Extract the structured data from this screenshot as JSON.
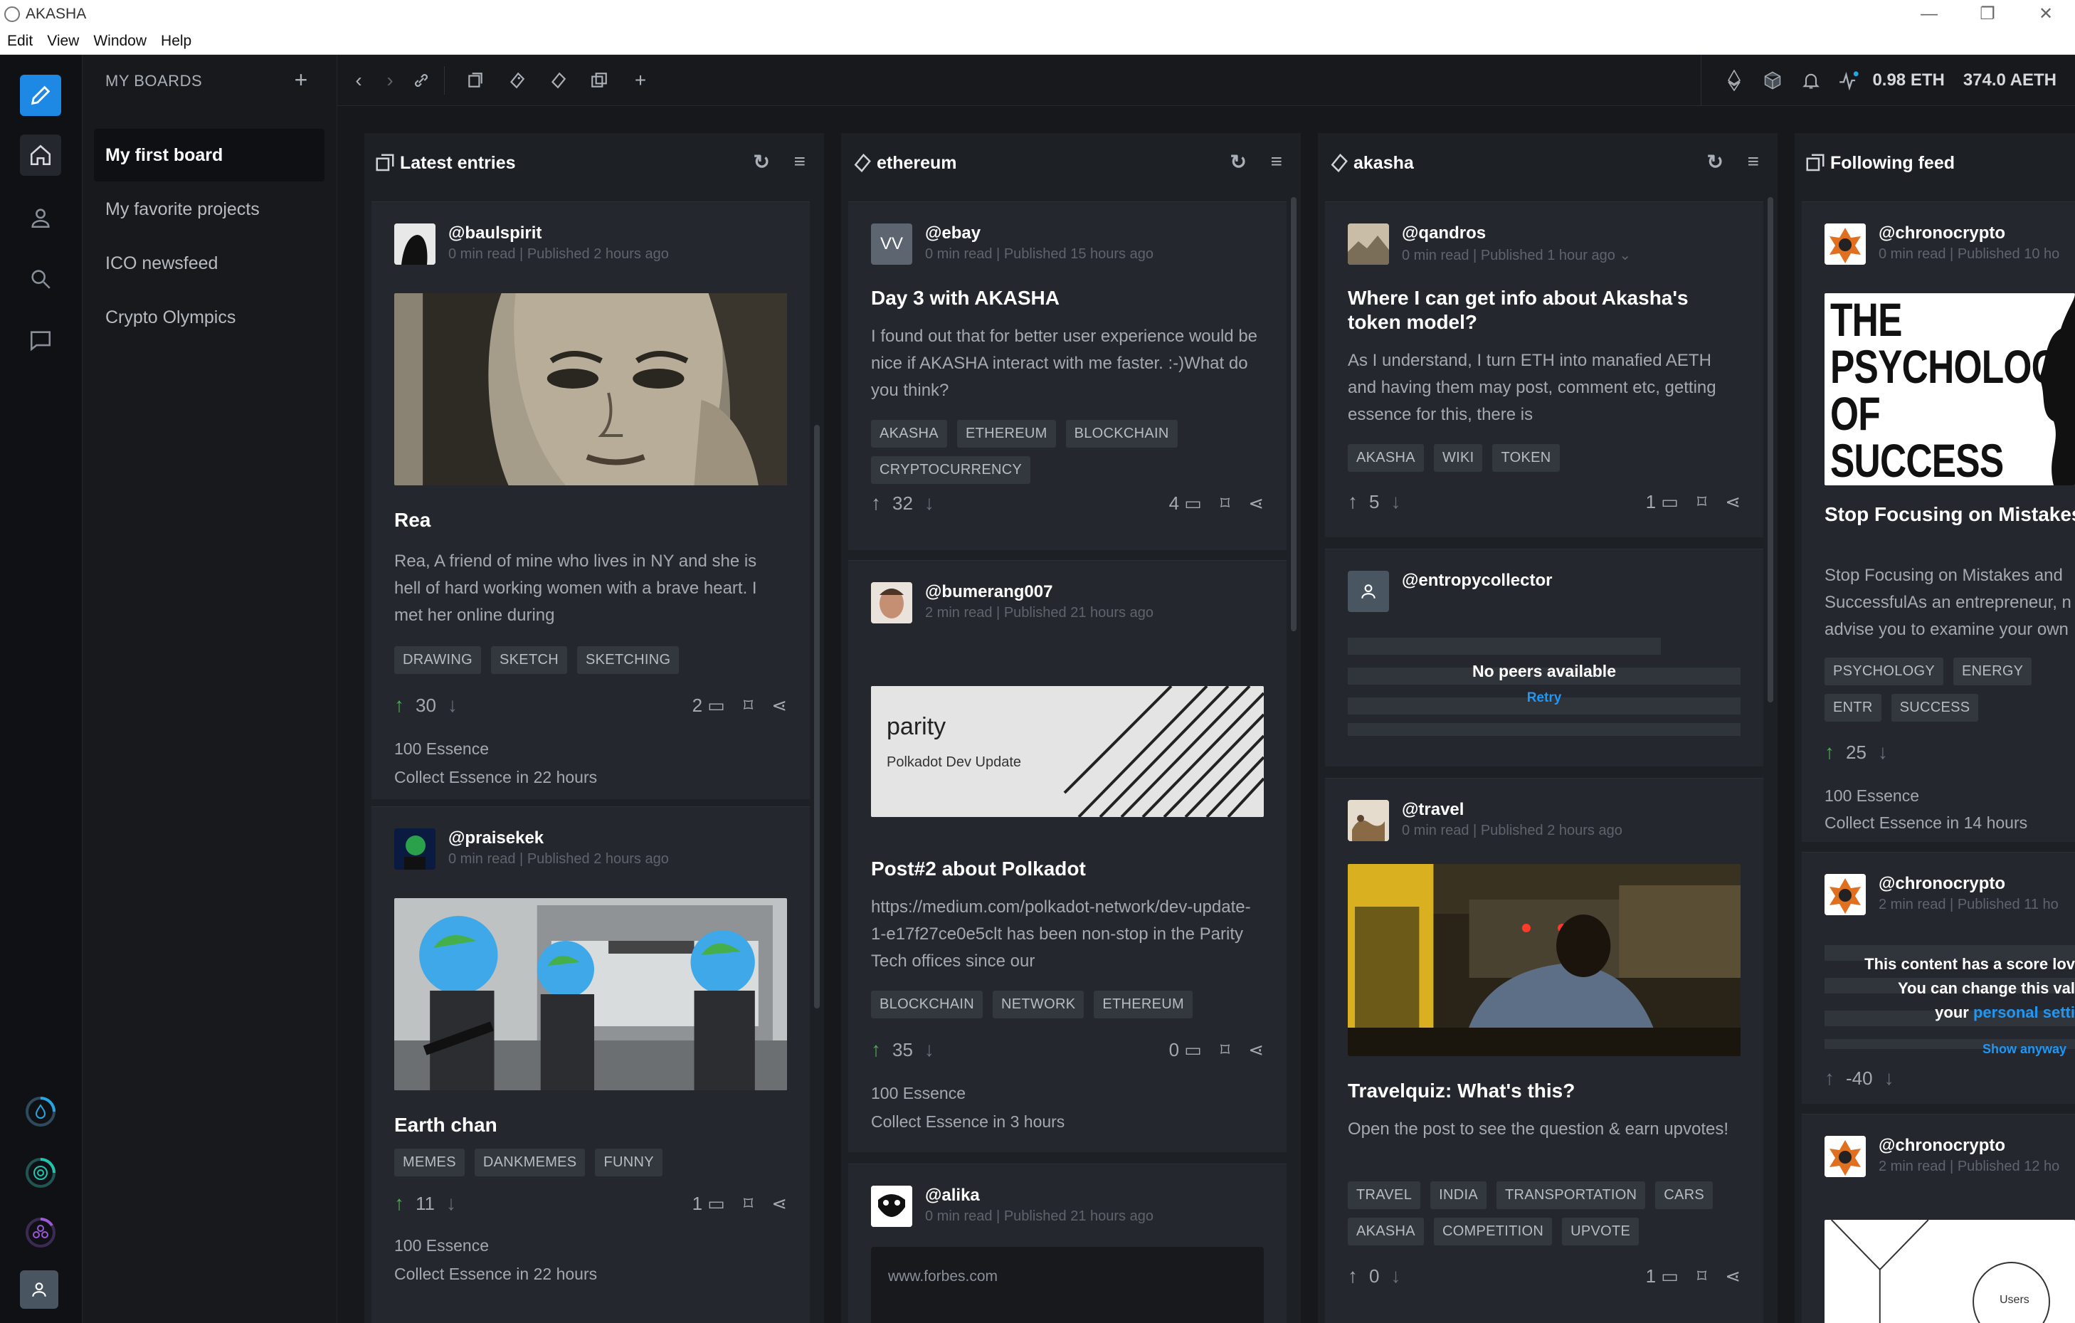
{
  "window": {
    "title": "AKASHA"
  },
  "menu": [
    "Edit",
    "View",
    "Window",
    "Help"
  ],
  "boards": {
    "header": "MY BOARDS",
    "items": [
      "My first board",
      "My favorite projects",
      "ICO newsfeed",
      "Crypto Olympics"
    ]
  },
  "balance": {
    "eth": "0.98 ETH",
    "aeth": "374.0 AETH"
  },
  "columns": [
    {
      "title": "Latest entries",
      "cards": [
        {
          "author": "@baulspirit",
          "read": "0 min  read",
          "published": "Published 2 hours ago",
          "title": "Rea",
          "excerpt": "Rea, A friend of mine who lives in NY and she is hell of hard working women with a brave heart. I met her online during",
          "tags": [
            "DRAWING",
            "SKETCH",
            "SKETCHING"
          ],
          "votes": "30",
          "comments": "2",
          "essence": "100 Essence",
          "collect": "Collect Essence in 22 hours"
        },
        {
          "author": "@praisekek",
          "read": "0 min  read",
          "published": "Published 2 hours ago",
          "title": "Earth chan",
          "tags": [
            "MEMES",
            "DANKMEMES",
            "FUNNY"
          ],
          "votes": "11",
          "comments": "1",
          "essence": "100 Essence",
          "collect": "Collect Essence in 22 hours"
        }
      ]
    },
    {
      "title": "ethereum",
      "cards": [
        {
          "author": "@ebay",
          "initials": "VV",
          "read": "0 min  read",
          "published": "Published 15 hours ago",
          "title": "Day 3 with AKASHA",
          "excerpt": "I found out that for better user experience would be nice if AKASHA interact with me faster. :-)What do you think?",
          "tags": [
            "AKASHA",
            "ETHEREUM",
            "BLOCKCHAIN",
            "CRYPTOCURRENCY"
          ],
          "votes": "32",
          "comments": "4"
        },
        {
          "author": "@bumerang007",
          "read": "2 min  read",
          "published": "Published 21 hours ago",
          "image_title": "parity",
          "image_sub": "Polkadot Dev Update",
          "title": "Post#2 about Polkadot",
          "excerpt": "https://medium.com/polkadot-network/dev-update-1-e17f27ce0e5clt has been non-stop in the Parity Tech offices since our",
          "tags": [
            "BLOCKCHAIN",
            "NETWORK",
            "ETHEREUM"
          ],
          "votes": "35",
          "comments": "0",
          "essence": "100 Essence",
          "collect": "Collect Essence in 3 hours"
        },
        {
          "author": "@alika",
          "read": "0 min  read",
          "published": "Published 21 hours ago",
          "link": "www.forbes.com"
        }
      ]
    },
    {
      "title": "akasha",
      "cards": [
        {
          "author": "@qandros",
          "read": "0 min  read",
          "published": "Published 1 hour ago",
          "title": "Where I can get info about Akasha's token model?",
          "excerpt": "As I understand, I turn ETH into manafied AETH and having them may post, comment etc, getting essence for this, there is",
          "tags": [
            "AKASHA",
            "WIKI",
            "TOKEN"
          ],
          "votes": "5",
          "comments": "1"
        },
        {
          "author": "@entropycollector",
          "no_peers": "No peers available",
          "retry": "Retry"
        },
        {
          "author": "@travel",
          "read": "0 min  read",
          "published": "Published 2 hours ago",
          "title": "Travelquiz: What's this?",
          "excerpt": "Open the post to see the question & earn upvotes!",
          "tags": [
            "TRAVEL",
            "INDIA",
            "TRANSPORTATION",
            "CARS",
            "AKASHA",
            "COMPETITION",
            "UPVOTE"
          ],
          "votes": "0",
          "comments": "1"
        }
      ]
    },
    {
      "title": "Following feed",
      "cards": [
        {
          "author": "@chronocrypto",
          "read": "0 min  read",
          "published": "Published 10 ho",
          "image_text": [
            "THE",
            "PSYCHOLOGY",
            "OF",
            "SUCCESS"
          ],
          "title": "Stop Focusing on Mistakes More Successful",
          "excerpt": "Stop Focusing on Mistakes and SuccessfulAs an entrepreneur, n advise you to examine your own",
          "tags": [
            "PSYCHOLOGY",
            "ENERGY",
            "ENTR",
            "SUCCESS"
          ],
          "votes": "25",
          "essence": "100 Essence",
          "collect": "Collect Essence in 14 hours"
        },
        {
          "author": "@chronocrypto",
          "read": "2 min  read",
          "published": "Published 11 ho",
          "low1": "This content has a score lov",
          "low2": "You can change this val",
          "low3a": "your",
          "low3b": "personal setti",
          "show": "Show anyway",
          "votes": "-40"
        },
        {
          "author": "@chronocrypto",
          "read": "2 min  read",
          "published": "Published 12 ho",
          "diagram_label": "Users"
        }
      ]
    }
  ]
}
